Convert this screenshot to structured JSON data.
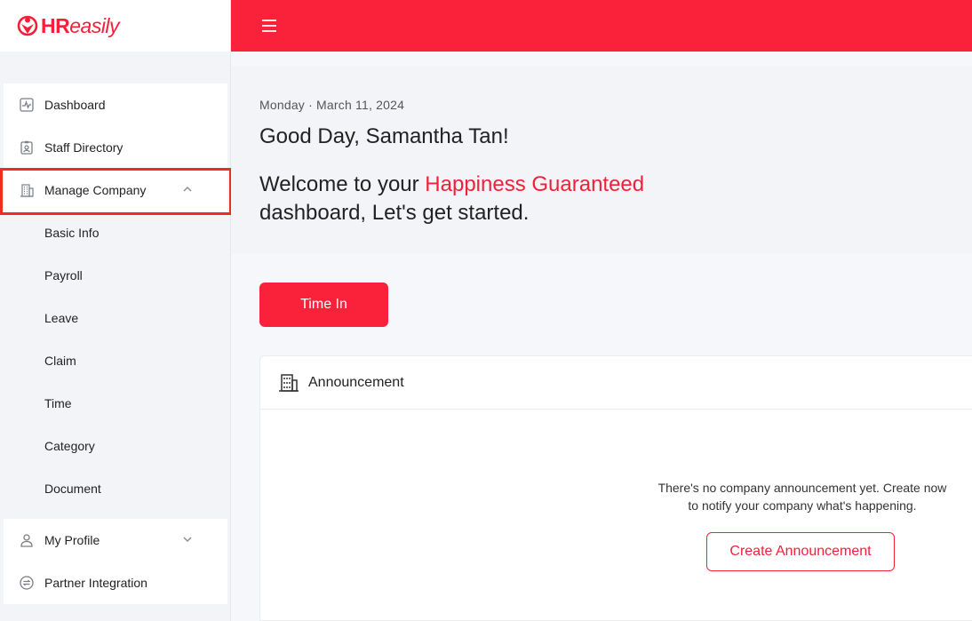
{
  "brand": {
    "logo_strong": "HR",
    "logo_light": "easily",
    "accent": "#f3203a"
  },
  "sidebar": {
    "items": [
      {
        "label": "Dashboard",
        "icon": "activity-icon"
      },
      {
        "label": "Staff Directory",
        "icon": "id-badge-icon"
      },
      {
        "label": "Manage Company",
        "icon": "building-icon",
        "expanded": true
      }
    ],
    "manage_company_sub": [
      {
        "label": "Basic Info"
      },
      {
        "label": "Payroll"
      },
      {
        "label": "Leave"
      },
      {
        "label": "Claim"
      },
      {
        "label": "Time"
      },
      {
        "label": "Category"
      },
      {
        "label": "Document"
      }
    ],
    "bottom_items": [
      {
        "label": "My Profile",
        "icon": "user-icon",
        "expanded": false
      },
      {
        "label": "Partner Integration",
        "icon": "swap-icon"
      }
    ]
  },
  "topbar": {
    "menu_icon": "hamburger-icon"
  },
  "welcome": {
    "date": "Monday · March 11, 2024",
    "greeting": "Good Day, Samantha Tan!",
    "line_prefix": "Welcome to your ",
    "line_accent": "Happiness Guaranteed",
    "line_suffix": "dashboard, Let's get started."
  },
  "actions": {
    "time_in_label": "Time In"
  },
  "announcement": {
    "title": "Announcement",
    "empty_line1": "There's no company announcement yet. Create now",
    "empty_line2": "to notify your company what's happening.",
    "create_label": "Create Announcement"
  }
}
